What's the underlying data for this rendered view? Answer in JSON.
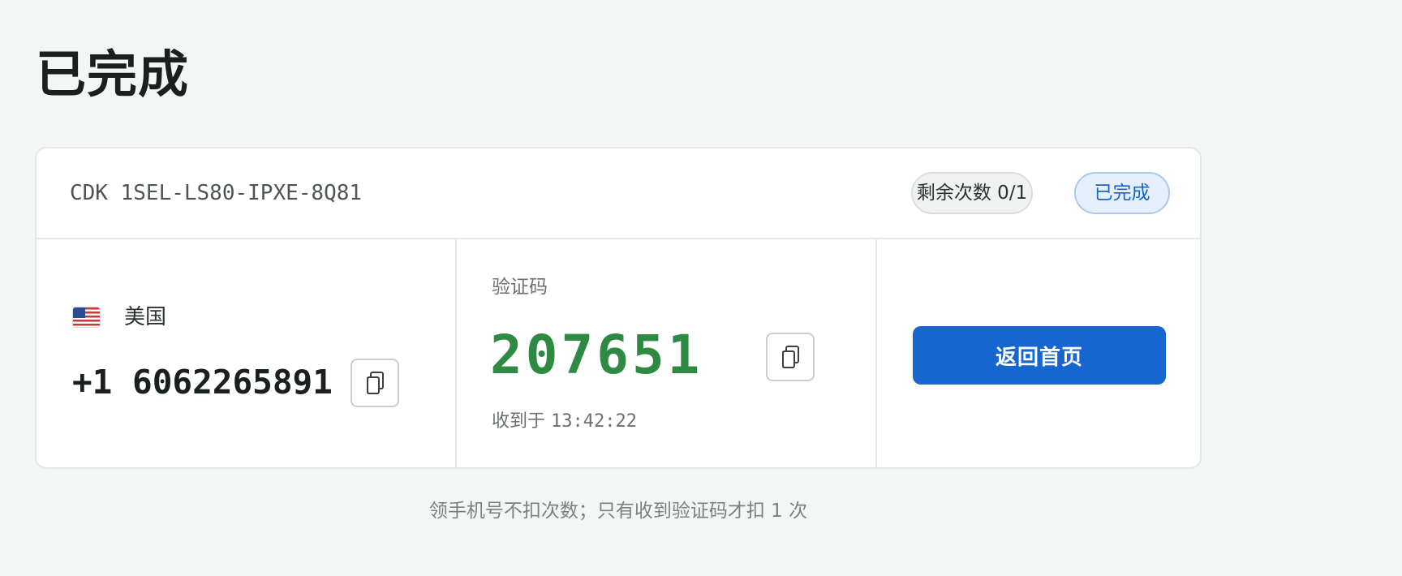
{
  "page": {
    "title": "已完成"
  },
  "card": {
    "cdk_text": "CDK 1SEL-LS80-IPXE-8Q81",
    "remaining_badge": "剩余次数 0/1",
    "status_badge": "已完成"
  },
  "phone": {
    "country_flag": "us-flag-icon",
    "country": "美国",
    "number": "+1 6062265891",
    "copy_icon": "copy-icon"
  },
  "code": {
    "label": "验证码",
    "value": "207651",
    "copy_icon": "copy-icon",
    "received_prefix": "收到于",
    "received_time": "13:42:22"
  },
  "action": {
    "home_label": "返回首页"
  },
  "footer": {
    "note": "领手机号不扣次数；只有收到验证码才扣 1 次"
  },
  "colors": {
    "background": "#f2f6f5",
    "primary": "#1766d0",
    "code_green": "#2e8a43",
    "status_blue": "#1667c9"
  }
}
